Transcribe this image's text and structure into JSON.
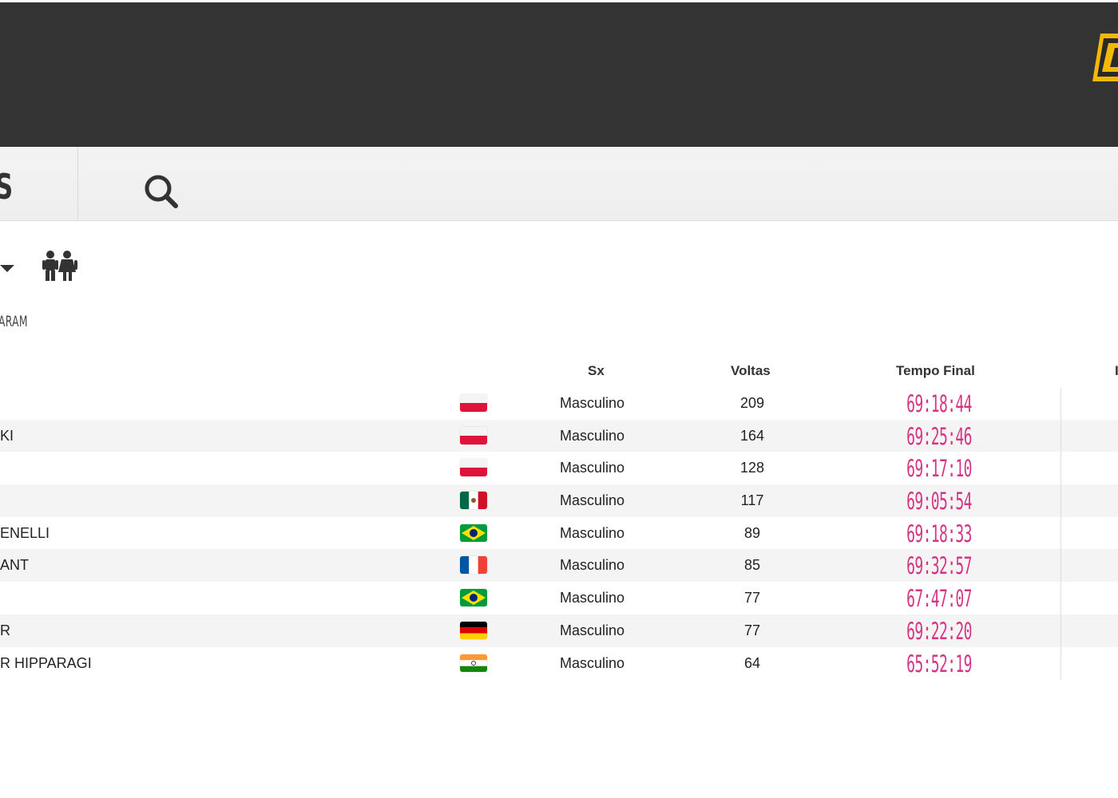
{
  "header": {
    "logo_icon": "brand-logo-icon"
  },
  "toolbar": {
    "tab_fragment": "S",
    "search_icon": "search-icon"
  },
  "filters": {
    "dropdown_icon": "caret-down-icon",
    "gender_icon": "gender-filter-icon"
  },
  "subtitle": "ARAM",
  "table": {
    "columns": {
      "sx": "Sx",
      "voltas": "Voltas",
      "tempo": "Tempo Final",
      "extra": "I"
    },
    "rows": [
      {
        "name": "",
        "country": "poland",
        "sx": "Masculino",
        "voltas": "209",
        "time": "69:18:44"
      },
      {
        "name": "KI",
        "country": "poland",
        "sx": "Masculino",
        "voltas": "164",
        "time": "69:25:46"
      },
      {
        "name": "",
        "country": "poland",
        "sx": "Masculino",
        "voltas": "128",
        "time": "69:17:10"
      },
      {
        "name": "",
        "country": "mexico",
        "sx": "Masculino",
        "voltas": "117",
        "time": "69:05:54"
      },
      {
        "name": "ENELLI",
        "country": "brazil",
        "sx": "Masculino",
        "voltas": "89",
        "time": "69:18:33"
      },
      {
        "name": "ANT",
        "country": "france",
        "sx": "Masculino",
        "voltas": "85",
        "time": "69:32:57"
      },
      {
        "name": "",
        "country": "brazil",
        "sx": "Masculino",
        "voltas": "77",
        "time": "67:47:07"
      },
      {
        "name": "R",
        "country": "germany",
        "sx": "Masculino",
        "voltas": "77",
        "time": "69:22:20"
      },
      {
        "name": "R HIPPARAGI",
        "country": "india",
        "sx": "Masculino",
        "voltas": "64",
        "time": "65:52:19"
      }
    ]
  },
  "colors": {
    "header_bg": "#333333",
    "time_color": "#d63384",
    "logo": "#f5b800"
  }
}
